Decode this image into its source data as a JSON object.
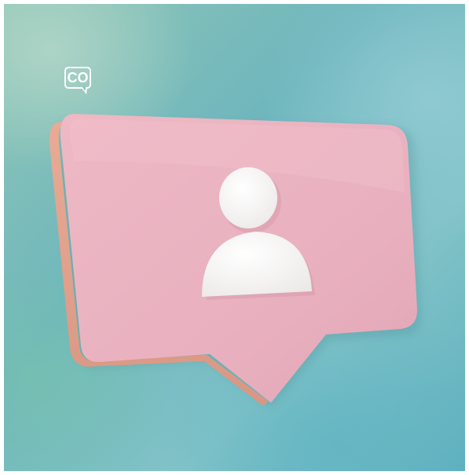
{
  "logo": {
    "text": "CO",
    "icon": "speech-bubble-logo-icon"
  },
  "scene": {
    "subject": "profile-notification-bubble",
    "icon": "user-profile-icon"
  },
  "colors": {
    "bubble_face": "#eab3c0",
    "bubble_edge": "#e0a38b",
    "bubble_shadow": "#c98f86",
    "person": "#f4f2f1",
    "logo": "#ffffff",
    "background_primary": "#6fb6bd",
    "background_secondary": "#8fc6b6"
  }
}
